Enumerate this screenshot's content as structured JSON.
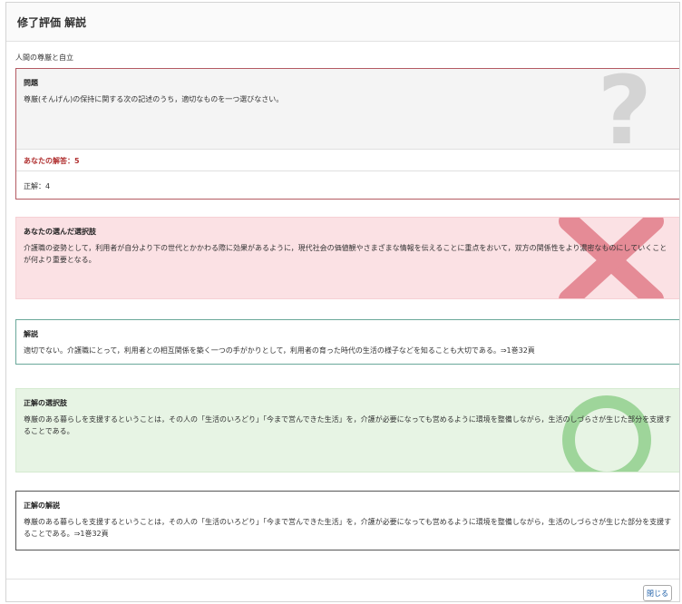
{
  "header": {
    "title": "修了評価 解説"
  },
  "subject": "人間の尊厳と自立",
  "question": {
    "title": "問題",
    "text": "尊厳(そんげん)の保持に関する次の記述のうち，適切なものを一つ選びなさい。",
    "your_answer": "あなたの解答：5",
    "correct_answer": "正解：4",
    "icon": "question-mark"
  },
  "your_choice": {
    "title": "あなたの選んだ選択肢",
    "text": "介護職の姿勢として，利用者が自分より下の世代とかかわる際に効果があるように，現代社会の価値観やさまざまな情報を伝えることに重点をおいて，双方の関係性をより濃密なものにしていくことが何より重要となる。",
    "icon": "cross-mark",
    "color": "#e58b96"
  },
  "explanation": {
    "title": "解説",
    "text": "適切でない。介護職にとって，利用者との相互関係を築く一つの手がかりとして，利用者の育った時代の生活の様子などを知ることも大切である。⇒1巻32頁"
  },
  "correct_choice": {
    "title": "正解の選択肢",
    "text": "尊厳のある暮らしを支援するということは，その人の「生活のいろどり」「今まで営んできた生活」を，介護が必要になっても営めるように環境を整備しながら，生活のしづらさが生じた部分を支援することである。",
    "icon": "circle-mark",
    "color": "#9ed59a"
  },
  "correct_explanation": {
    "title": "正解の解説",
    "text": "尊厳のある暮らしを支援するということは，その人の「生活のいろどり」「今まで営んできた生活」を，介護が必要になっても営めるように環境を整備しながら，生活のしづらさが生じた部分を支援することである。⇒1巻32頁"
  },
  "footer": {
    "close_label": "閉じる"
  }
}
